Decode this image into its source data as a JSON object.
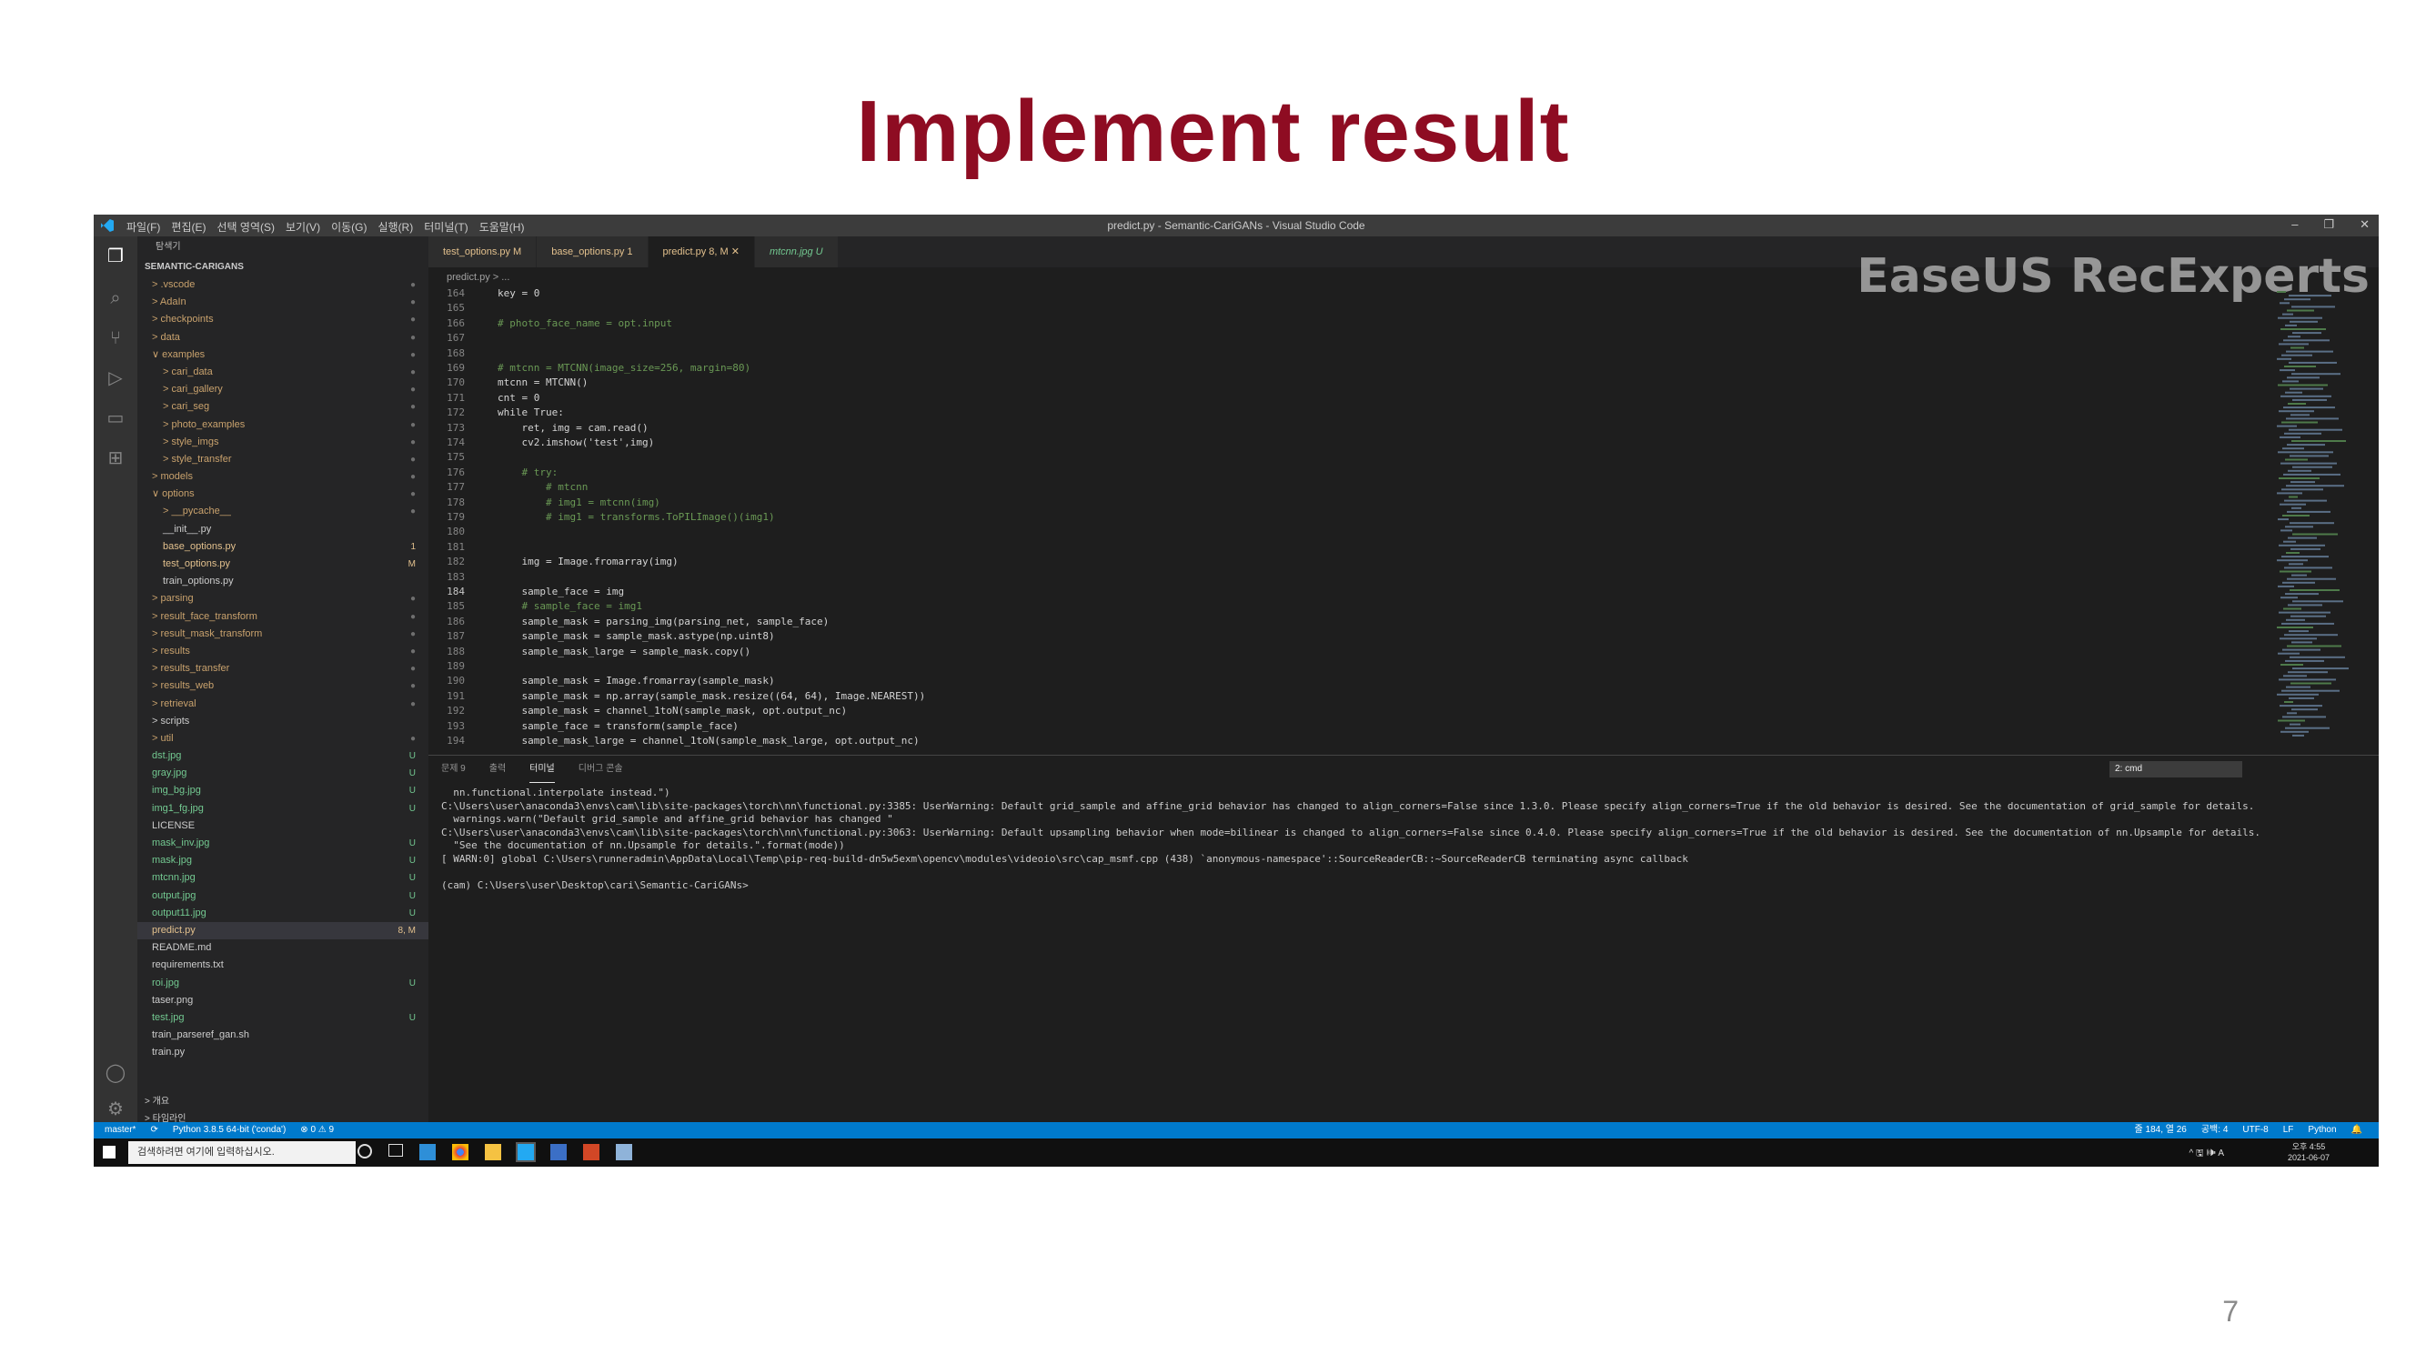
{
  "slide": {
    "title": "Implement result",
    "page_number": "7"
  },
  "window": {
    "menu": [
      "파일(F)",
      "편집(E)",
      "선택 영역(S)",
      "보기(V)",
      "이동(G)",
      "실행(R)",
      "터미널(T)",
      "도움말(H)"
    ],
    "title": "predict.py - Semantic-CariGANs - Visual Studio Code",
    "controls": [
      "–",
      "❐",
      "✕"
    ]
  },
  "watermark": "EaseUS RecExperts",
  "explorer": {
    "header": "탐색기",
    "project": "SEMANTIC-CARIGANS",
    "items": [
      {
        "name": "> .vscode",
        "badge": "●"
      },
      {
        "name": "> AdaIn",
        "badge": "●"
      },
      {
        "name": "> checkpoints",
        "badge": "●"
      },
      {
        "name": "> data",
        "badge": "●"
      },
      {
        "name": "∨ examples",
        "badge": "●"
      },
      {
        "name": "> cari_data",
        "badge": "●"
      },
      {
        "name": "> cari_gallery",
        "badge": "●"
      },
      {
        "name": "> cari_seg",
        "badge": "●"
      },
      {
        "name": "> photo_examples",
        "badge": "●"
      },
      {
        "name": "> style_imgs",
        "badge": "●"
      },
      {
        "name": "> style_transfer",
        "badge": "●"
      },
      {
        "name": "> models",
        "badge": "●"
      },
      {
        "name": "∨ options",
        "badge": "●"
      },
      {
        "name": "> __pycache__",
        "badge": "●"
      },
      {
        "name": "__init__.py",
        "badge": ""
      },
      {
        "name": "base_options.py",
        "badge": "1"
      },
      {
        "name": "test_options.py",
        "badge": "M"
      },
      {
        "name": "train_options.py",
        "badge": ""
      },
      {
        "name": "> parsing",
        "badge": "●"
      },
      {
        "name": "> result_face_transform",
        "badge": "●"
      },
      {
        "name": "> result_mask_transform",
        "badge": "●"
      },
      {
        "name": "> results",
        "badge": "●"
      },
      {
        "name": "> results_transfer",
        "badge": "●"
      },
      {
        "name": "> results_web",
        "badge": "●"
      },
      {
        "name": "> retrieval",
        "badge": "●"
      },
      {
        "name": "> scripts",
        "badge": ""
      },
      {
        "name": "> util",
        "badge": "●"
      },
      {
        "name": "dst.jpg",
        "badge": "U"
      },
      {
        "name": "gray.jpg",
        "badge": "U"
      },
      {
        "name": "img_bg.jpg",
        "badge": "U"
      },
      {
        "name": "img1_fg.jpg",
        "badge": "U"
      },
      {
        "name": "LICENSE",
        "badge": ""
      },
      {
        "name": "mask_inv.jpg",
        "badge": "U"
      },
      {
        "name": "mask.jpg",
        "badge": "U"
      },
      {
        "name": "mtcnn.jpg",
        "badge": "U"
      },
      {
        "name": "output.jpg",
        "badge": "U"
      },
      {
        "name": "output11.jpg",
        "badge": "U"
      },
      {
        "name": "predict.py",
        "badge": "8, M"
      },
      {
        "name": "README.md",
        "badge": ""
      },
      {
        "name": "requirements.txt",
        "badge": ""
      },
      {
        "name": "roi.jpg",
        "badge": "U"
      },
      {
        "name": "taser.png",
        "badge": ""
      },
      {
        "name": "test.jpg",
        "badge": "U"
      },
      {
        "name": "train_parseref_gan.sh",
        "badge": ""
      },
      {
        "name": "train.py",
        "badge": ""
      }
    ],
    "bottom": [
      "> 개요",
      "> 타임라인"
    ]
  },
  "tabs": [
    {
      "label": "test_options.py  M"
    },
    {
      "label": "base_options.py  1"
    },
    {
      "label": "predict.py  8, M  ✕"
    },
    {
      "label": "mtcnn.jpg  U"
    }
  ],
  "breadcrumb": "predict.py > ...",
  "code_lines": [
    {
      "n": "164",
      "t": "key = 0",
      "c": false
    },
    {
      "n": "165",
      "t": "",
      "c": false
    },
    {
      "n": "166",
      "t": "# photo_face_name = opt.input",
      "c": true
    },
    {
      "n": "167",
      "t": "",
      "c": false
    },
    {
      "n": "168",
      "t": "",
      "c": false
    },
    {
      "n": "169",
      "t": "# mtcnn = MTCNN(image_size=256, margin=80)",
      "c": true
    },
    {
      "n": "170",
      "t": "mtcnn = MTCNN()",
      "c": false
    },
    {
      "n": "171",
      "t": "cnt = 0",
      "c": false
    },
    {
      "n": "172",
      "t": "while True:",
      "c": false
    },
    {
      "n": "173",
      "t": "    ret, img = cam.read()",
      "c": false
    },
    {
      "n": "174",
      "t": "    cv2.imshow('test',img)",
      "c": false
    },
    {
      "n": "175",
      "t": "",
      "c": false
    },
    {
      "n": "176",
      "t": "    # try:",
      "c": true
    },
    {
      "n": "177",
      "t": "        # mtcnn",
      "c": true
    },
    {
      "n": "178",
      "t": "        # img1 = mtcnn(img)",
      "c": true
    },
    {
      "n": "179",
      "t": "        # img1 = transforms.ToPILImage()(img1)",
      "c": true
    },
    {
      "n": "180",
      "t": "",
      "c": false
    },
    {
      "n": "181",
      "t": "",
      "c": false
    },
    {
      "n": "182",
      "t": "    img = Image.fromarray(img)",
      "c": false
    },
    {
      "n": "183",
      "t": "",
      "c": false
    },
    {
      "n": "184",
      "t": "    sample_face = img",
      "c": false
    },
    {
      "n": "185",
      "t": "    # sample_face = img1",
      "c": true
    },
    {
      "n": "186",
      "t": "    sample_mask = parsing_img(parsing_net, sample_face)",
      "c": false
    },
    {
      "n": "187",
      "t": "    sample_mask = sample_mask.astype(np.uint8)",
      "c": false
    },
    {
      "n": "188",
      "t": "    sample_mask_large = sample_mask.copy()",
      "c": false
    },
    {
      "n": "189",
      "t": "",
      "c": false
    },
    {
      "n": "190",
      "t": "    sample_mask = Image.fromarray(sample_mask)",
      "c": false
    },
    {
      "n": "191",
      "t": "    sample_mask = np.array(sample_mask.resize((64, 64), Image.NEAREST))",
      "c": false
    },
    {
      "n": "192",
      "t": "    sample_mask = channel_1toN(sample_mask, opt.output_nc)",
      "c": false
    },
    {
      "n": "193",
      "t": "    sample_face = transform(sample_face)",
      "c": false
    },
    {
      "n": "194",
      "t": "    sample_mask_large = channel_1toN(sample_mask_large, opt.output_nc)",
      "c": false
    }
  ],
  "panel": {
    "tabs": [
      "문제 9",
      "출력",
      "터미널",
      "디버그 콘솔"
    ],
    "terminal_select": "2: cmd",
    "terminal_lines": [
      "  nn.functional.interpolate instead.\")",
      "C:\\Users\\user\\anaconda3\\envs\\cam\\lib\\site-packages\\torch\\nn\\functional.py:3385: UserWarning: Default grid_sample and affine_grid behavior has changed to align_corners=False since 1.3.0. Please specify align_corners=True if the old behavior is desired. See the documentation of grid_sample for details.",
      "  warnings.warn(\"Default grid_sample and affine_grid behavior has changed \"",
      "C:\\Users\\user\\anaconda3\\envs\\cam\\lib\\site-packages\\torch\\nn\\functional.py:3063: UserWarning: Default upsampling behavior when mode=bilinear is changed to align_corners=False since 0.4.0. Please specify align_corners=True if the old behavior is desired. See the documentation of nn.Upsample for details.",
      "  \"See the documentation of nn.Upsample for details.\".format(mode))",
      "[ WARN:0] global C:\\Users\\runneradmin\\AppData\\Local\\Temp\\pip-req-build-dn5w5exm\\opencv\\modules\\videoio\\src\\cap_msmf.cpp (438) `anonymous-namespace'::SourceReaderCB::~SourceReaderCB terminating async callback",
      "",
      "(cam) C:\\Users\\user\\Desktop\\cari\\Semantic-CariGANs>"
    ]
  },
  "statusbar": {
    "left": [
      "master*",
      "⟳",
      "Python 3.8.5 64-bit ('conda')",
      "⊗ 0 ⚠ 9"
    ],
    "right": [
      "줄 184, 열 26",
      "공백: 4",
      "UTF-8",
      "LF",
      "Python",
      "🔔"
    ]
  },
  "taskbar": {
    "search_placeholder": "검색하려면 여기에 입력하십시오.",
    "tray": "^ 🖫 🕪 A",
    "time": "오후 4:55",
    "date": "2021-06-07"
  },
  "colors": {
    "title": "#8e0c22",
    "status_bar": "#007acc",
    "modified": "#e2c08d",
    "untracked": "#73c991"
  }
}
